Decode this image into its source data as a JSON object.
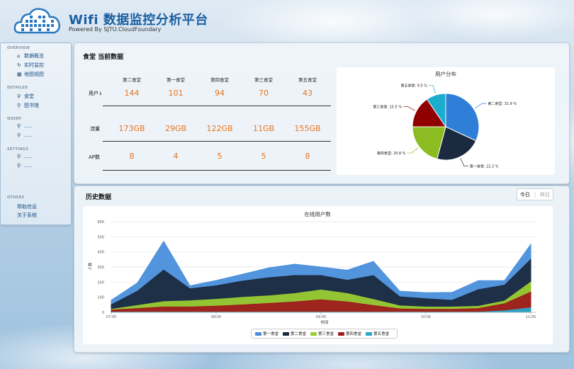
{
  "header": {
    "title": "Wifi 数据监控分析平台",
    "subtitle": "Powered By SJTU.CloudFoundary"
  },
  "sidebar": {
    "sections": [
      {
        "heading": "OVERVIEW",
        "items": [
          {
            "label": "数据概览",
            "icon": "home-icon"
          },
          {
            "label": "实时监控",
            "icon": "refresh-icon"
          },
          {
            "label": "地图视图",
            "icon": "image-icon"
          }
        ]
      },
      {
        "heading": "DETAILED",
        "items": [
          {
            "label": "食堂",
            "icon": "search-icon"
          },
          {
            "label": "图书馆",
            "icon": "search-icon"
          }
        ]
      },
      {
        "heading": "QUERY",
        "items": [
          {
            "label": ".....",
            "icon": "search-icon"
          },
          {
            "label": ".....",
            "icon": "search-icon"
          }
        ]
      },
      {
        "heading": "SETTINGS",
        "items": [
          {
            "label": ".....",
            "icon": "search-icon"
          },
          {
            "label": ".....",
            "icon": "search-icon"
          }
        ]
      },
      {
        "heading": "OTHERS",
        "items": [
          {
            "label": "帮助信息"
          },
          {
            "label": "关于系统"
          }
        ]
      }
    ]
  },
  "current": {
    "title": "食堂 当前数据",
    "columns": [
      "第二食堂",
      "第一食堂",
      "第四食堂",
      "第三食堂",
      "第五食堂"
    ],
    "rows": [
      {
        "label": "用户↓",
        "values": [
          "144",
          "101",
          "94",
          "70",
          "43"
        ]
      },
      {
        "label": "流量",
        "values": [
          "173GB",
          "29GB",
          "122GB",
          "11GB",
          "155GB"
        ]
      },
      {
        "label": "AP数",
        "values": [
          "8",
          "4",
          "5",
          "5",
          "8"
        ]
      }
    ]
  },
  "history": {
    "title": "历史数据",
    "tabs": [
      "今日",
      "昨日"
    ],
    "tab_separator": "|"
  },
  "colors": {
    "first": "#4a8fdb",
    "second": "#1b2a3f",
    "third": "#99cc33",
    "fourth": "#9e1c1c",
    "fifth": "#2aa7c9",
    "accent_value": "#e8741c",
    "title_blue": "#1b5fa0"
  },
  "chart_data": [
    {
      "type": "pie",
      "title": "用户分布",
      "series": [
        {
          "name": "第二食堂",
          "label": "第二食堂: 31.9 %",
          "value": 31.9,
          "color": "#2f7ed8"
        },
        {
          "name": "第一食堂",
          "label": "第一食堂: 22.3 %",
          "value": 22.3,
          "color": "#1b2a3f"
        },
        {
          "name": "第四食堂",
          "label": "第四食堂: 20.8 %",
          "value": 20.8,
          "color": "#8bbc21"
        },
        {
          "name": "第三食堂",
          "label": "第三食堂: 15.5 %",
          "value": 15.5,
          "color": "#910000"
        },
        {
          "name": "第五食堂",
          "label": "第五食堂: 9.5 %",
          "value": 9.5,
          "color": "#1aadce"
        }
      ]
    },
    {
      "type": "area",
      "stacked": true,
      "title": "在线用户数",
      "xlabel": "时间",
      "ylabel": "人数",
      "ylim": [
        0,
        600
      ],
      "yticks": [
        "0",
        "100",
        "200",
        "300",
        "400",
        "500",
        "600"
      ],
      "xticks": [
        "07:05",
        "08:05",
        "09:05",
        "10:05",
        "11:05"
      ],
      "x": [
        "07:05",
        "07:20",
        "07:35",
        "07:50",
        "08:05",
        "08:20",
        "08:35",
        "08:50",
        "09:05",
        "09:20",
        "09:35",
        "09:50",
        "10:05",
        "10:20",
        "10:35",
        "10:50",
        "11:05"
      ],
      "legend_position": "bottom",
      "series": [
        {
          "name": "第五食堂",
          "color": "#2aa7c9",
          "values": [
            1,
            1,
            1,
            1,
            1,
            1,
            1,
            1,
            1,
            1,
            1,
            1,
            1,
            1,
            1,
            10,
            30
          ]
        },
        {
          "name": "第四食堂",
          "color": "#9e1c1c",
          "values": [
            14,
            24,
            35,
            35,
            40,
            48,
            58,
            68,
            82,
            68,
            44,
            22,
            19,
            19,
            24,
            47,
            104
          ]
        },
        {
          "name": "第三食堂",
          "color": "#99cc33",
          "values": [
            5,
            20,
            35,
            40,
            45,
            50,
            50,
            55,
            65,
            55,
            40,
            20,
            15,
            15,
            15,
            18,
            66
          ]
        },
        {
          "name": "第二食堂",
          "color": "#1b2a3f",
          "values": [
            30,
            95,
            209,
            80,
            90,
            108,
            120,
            120,
            96,
            88,
            158,
            60,
            55,
            45,
            110,
            105,
            150
          ]
        },
        {
          "name": "第一食堂",
          "color": "#4a8fdb",
          "values": [
            30,
            55,
            190,
            20,
            35,
            45,
            65,
            75,
            56,
            67,
            94,
            37,
            40,
            52,
            60,
            30,
            100
          ]
        }
      ]
    }
  ]
}
